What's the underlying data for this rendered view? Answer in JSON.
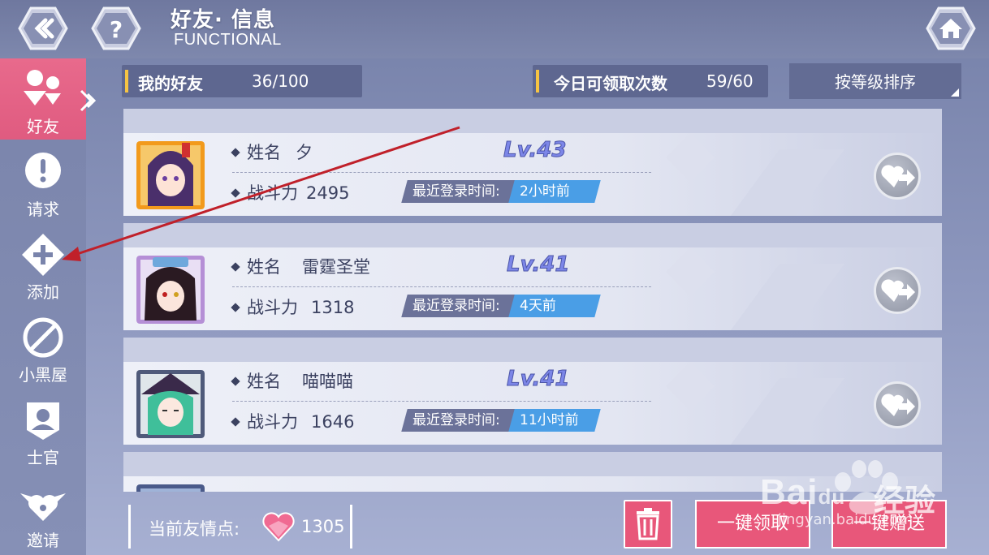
{
  "header": {
    "title": "好友· 信息",
    "subtitle": "FUNCTIONAL"
  },
  "sidebar": {
    "items": [
      {
        "label": "好友",
        "icon": "friends-icon"
      },
      {
        "label": "请求",
        "icon": "exclamation-icon"
      },
      {
        "label": "添加",
        "icon": "add-icon"
      },
      {
        "label": "小黑屋",
        "icon": "block-icon"
      },
      {
        "label": "士官",
        "icon": "officer-icon"
      },
      {
        "label": "邀请",
        "icon": "invite-icon"
      }
    ]
  },
  "friends_bar": {
    "label": "我的好友",
    "value": "36/100"
  },
  "claims_bar": {
    "label": "今日可领取次数",
    "value": "59/60"
  },
  "sort": {
    "label": "按等级排序"
  },
  "friends": [
    {
      "name_label": "姓名",
      "name": "夕",
      "power_label": "战斗力",
      "power": "2495",
      "level": "Lv.43",
      "login_label": "最近登录时间:",
      "login": "2小时前"
    },
    {
      "name_label": "姓名",
      "name": "雷霆圣堂",
      "power_label": "战斗力",
      "power": "1318",
      "level": "Lv.41",
      "login_label": "最近登录时间:",
      "login": "4天前"
    },
    {
      "name_label": "姓名",
      "name": "喵喵喵",
      "power_label": "战斗力",
      "power": "1646",
      "level": "Lv.41",
      "login_label": "最近登录时间:",
      "login": "11小时前"
    }
  ],
  "bottom": {
    "points_label": "当前友情点:",
    "points": "1305",
    "claim_all": "一键领取",
    "send_all": "一键赠送"
  },
  "watermark": {
    "brand": "Bai",
    "brand2": "du",
    "cn": "经验",
    "url": "jingyan.baidu.com"
  },
  "colors": {
    "accent_pink": "#e8577a",
    "login_blue": "#4a9ee6",
    "annotation_red": "#c0202a"
  }
}
